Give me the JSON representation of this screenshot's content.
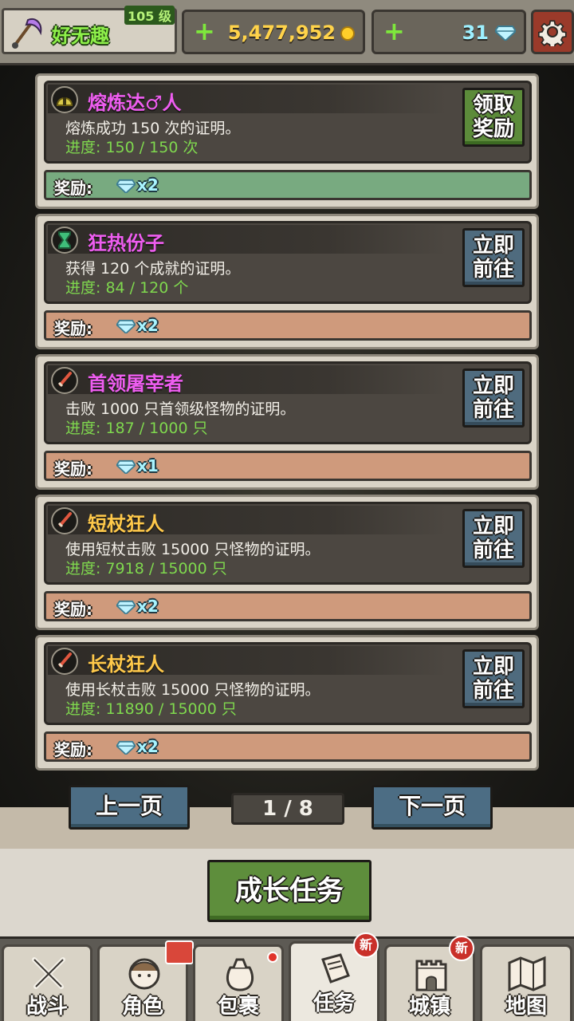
{
  "player": {
    "name": "好无趣",
    "level": "105 级"
  },
  "currency": {
    "gold": "5,477,952",
    "gems": "31",
    "plus_symbol": "+"
  },
  "quests": [
    {
      "title": "熔炼达♂人",
      "title_color": "#ee5df0",
      "description": "熔炼成功 150 次的证明。",
      "progress": "进度: 150 / 150 次",
      "button": "领取奖励",
      "button_line1": "领取",
      "button_line2": "奖励",
      "reward_label": "奖励:",
      "reward_count": "x2",
      "icon": "helmet-icon"
    },
    {
      "title": "狂热份子",
      "title_color": "#ee5df0",
      "description": "获得 120 个成就的证明。",
      "progress": "进度: 84 / 120 个",
      "button_line1": "立即",
      "button_line2": "前往",
      "reward_label": "奖励:",
      "reward_count": "x2",
      "icon": "hourglass-icon"
    },
    {
      "title": "首领屠宰者",
      "title_color": "#ee5df0",
      "description": "击败 1000 只首领级怪物的证明。",
      "progress": "进度: 187 / 1000 只",
      "button_line1": "立即",
      "button_line2": "前往",
      "reward_label": "奖励:",
      "reward_count": "x1",
      "icon": "sword-icon"
    },
    {
      "title": "短杖狂人",
      "title_color": "#ffc94a",
      "description": "使用短杖击败 15000 只怪物的证明。",
      "progress": "进度: 7918 / 15000 只",
      "button_line1": "立即",
      "button_line2": "前往",
      "reward_label": "奖励:",
      "reward_count": "x2",
      "icon": "sword-icon"
    },
    {
      "title": "长杖狂人",
      "title_color": "#ffc94a",
      "description": "使用长杖击败 15000 只怪物的证明。",
      "progress": "进度: 11890 / 15000 只",
      "button_line1": "立即",
      "button_line2": "前往",
      "reward_label": "奖励:",
      "reward_count": "x2",
      "icon": "sword-icon"
    }
  ],
  "pager": {
    "prev": "上一页",
    "next": "下一页",
    "current": "1 / 8"
  },
  "growth_task": "成长任务",
  "nav": {
    "tabs": [
      {
        "label": "战斗",
        "icon": "crossed-swords-icon"
      },
      {
        "label": "角色",
        "icon": "character-icon"
      },
      {
        "label": "包裹",
        "icon": "bag-icon"
      },
      {
        "label": "任务",
        "icon": "quest-icon"
      },
      {
        "label": "城镇",
        "icon": "castle-icon"
      },
      {
        "label": "地图",
        "icon": "map-icon"
      }
    ],
    "badge_new": "新"
  }
}
